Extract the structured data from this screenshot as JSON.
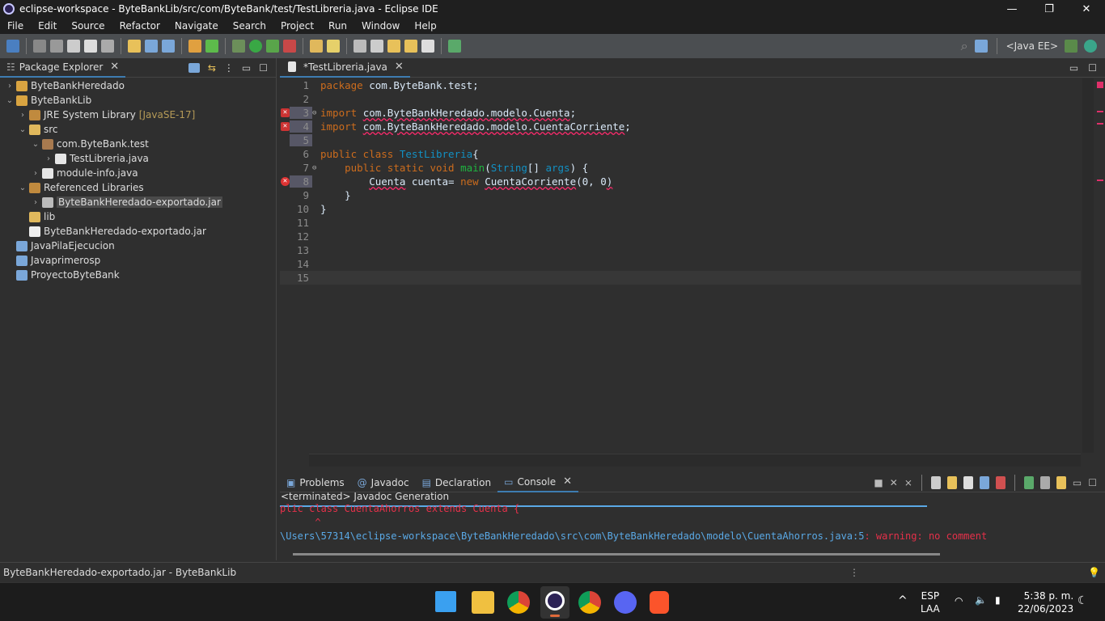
{
  "window": {
    "title": "eclipse-workspace - ByteBankLib/src/com/ByteBank/test/TestLibreria.java - Eclipse IDE",
    "minimize": "—",
    "maximize": "❐",
    "close": "✕"
  },
  "menu": [
    "File",
    "Edit",
    "Source",
    "Refactor",
    "Navigate",
    "Search",
    "Project",
    "Run",
    "Window",
    "Help"
  ],
  "toolbar": {
    "perspective": "<Java EE>"
  },
  "explorer": {
    "tab": "Package Explorer",
    "items": [
      {
        "label": "ByteBankHeredado",
        "depth": 0,
        "chev": "›",
        "icon": "project-warning-icon",
        "color": "#d9a441"
      },
      {
        "label": "ByteBankLib",
        "depth": 0,
        "chev": "⌄",
        "icon": "project-icon",
        "color": "#d9a441"
      },
      {
        "label": "JRE System Library",
        "deco": "[JavaSE-17]",
        "depth": 1,
        "chev": "›",
        "icon": "library-icon",
        "color": "#c08a3e"
      },
      {
        "label": "src",
        "depth": 1,
        "chev": "⌄",
        "icon": "source-folder-icon",
        "color": "#e0b85c"
      },
      {
        "label": "com.ByteBank.test",
        "depth": 2,
        "chev": "⌄",
        "icon": "package-icon",
        "color": "#a87a4f"
      },
      {
        "label": "TestLibreria.java",
        "depth": 3,
        "chev": "›",
        "icon": "java-file-icon",
        "color": "#e6e6e6"
      },
      {
        "label": "module-info.java",
        "depth": 2,
        "chev": "›",
        "icon": "java-file-icon",
        "color": "#e6e6e6"
      },
      {
        "label": "Referenced Libraries",
        "depth": 1,
        "chev": "⌄",
        "icon": "library-icon",
        "color": "#c08a3e"
      },
      {
        "label": "ByteBankHeredado-exportado.jar",
        "depth": 2,
        "chev": "›",
        "icon": "jar-icon",
        "color": "#bbbbbb",
        "selected": true
      },
      {
        "label": "lib",
        "depth": 1,
        "chev": "",
        "icon": "folder-icon",
        "color": "#e0b85c"
      },
      {
        "label": "ByteBankHeredado-exportado.jar",
        "depth": 1,
        "chev": "",
        "icon": "file-icon",
        "color": "#eeeeee"
      },
      {
        "label": "JavaPilaEjecucion",
        "depth": 0,
        "chev": "",
        "icon": "closed-project-icon",
        "color": "#7aa7d9"
      },
      {
        "label": "Javaprimerosp",
        "depth": 0,
        "chev": "",
        "icon": "closed-project-icon",
        "color": "#7aa7d9"
      },
      {
        "label": "ProyectoByteBank",
        "depth": 0,
        "chev": "",
        "icon": "closed-project-icon",
        "color": "#7aa7d9"
      }
    ]
  },
  "editor": {
    "tab": "*TestLibreria.java",
    "lines": [
      {
        "n": "1",
        "t": [
          [
            "kw",
            "package "
          ],
          [
            "",
            "com.ByteBank.test;"
          ]
        ]
      },
      {
        "n": "2",
        "t": []
      },
      {
        "n": "3",
        "mark": true,
        "gutter": "error-bulb",
        "fold": true,
        "t": [
          [
            "kw",
            "import "
          ],
          [
            "err",
            "com.ByteBankHeredado.modelo.Cuenta"
          ],
          [
            "",
            ";"
          ]
        ]
      },
      {
        "n": "4",
        "mark": true,
        "gutter": "error-bulb",
        "t": [
          [
            "kw",
            "import "
          ],
          [
            "err",
            "com.ByteBankHeredado.modelo.CuentaCorriente"
          ],
          [
            "",
            ";"
          ]
        ]
      },
      {
        "n": "5",
        "mark": true,
        "t": []
      },
      {
        "n": "6",
        "t": [
          [
            "kw",
            "public class "
          ],
          [
            "cls",
            "TestLibreria"
          ],
          [
            "",
            "{"
          ]
        ]
      },
      {
        "n": "7",
        "fold": true,
        "t": [
          [
            "",
            "    "
          ],
          [
            "kw",
            "public static void "
          ],
          [
            "mth",
            "main"
          ],
          [
            "",
            "("
          ],
          [
            "cls",
            "String"
          ],
          [
            "",
            "[] "
          ],
          [
            "cls",
            "args"
          ],
          [
            "",
            ") {"
          ]
        ]
      },
      {
        "n": "8",
        "mark": true,
        "gutter": "error",
        "t": [
          [
            "",
            "        "
          ],
          [
            "err",
            "Cuenta"
          ],
          [
            "",
            " cuenta= "
          ],
          [
            "kw",
            "new "
          ],
          [
            "err",
            "CuentaCorriente"
          ],
          [
            "",
            "(0, 0"
          ],
          [
            "err",
            ")"
          ]
        ]
      },
      {
        "n": "9",
        "t": [
          [
            "",
            "    }"
          ]
        ]
      },
      {
        "n": "10",
        "t": [
          [
            "",
            "}"
          ]
        ]
      },
      {
        "n": "11",
        "t": []
      },
      {
        "n": "12",
        "t": []
      },
      {
        "n": "13",
        "t": []
      },
      {
        "n": "14",
        "t": []
      },
      {
        "n": "15",
        "cur": true,
        "t": []
      }
    ]
  },
  "bottom": {
    "tabs": [
      "Problems",
      "Javadoc",
      "Declaration",
      "Console"
    ],
    "active": "Console",
    "console_title": "<terminated> Javadoc Generation",
    "lines": [
      {
        "text": "plic class CuentaAhorros extends Cuenta {",
        "color": "#e6304a"
      },
      {
        "text": "      ^",
        "color": "#e6304a"
      },
      {
        "parts": [
          {
            "text": "\\Users\\57314\\eclipse-workspace\\ByteBankHeredado\\src\\com\\ByteBankHeredado\\modelo\\CuentaAhorros.java:5",
            "color": "#5aa9e6"
          },
          {
            "text": ": warning: no comment",
            "color": "#e6304a"
          }
        ]
      }
    ]
  },
  "status": {
    "text": "ByteBankHeredado-exportado.jar - ByteBankLib"
  },
  "taskbar": {
    "lang1": "ESP",
    "lang2": "LAA",
    "time": "5:38 p. m.",
    "date": "22/06/2023"
  },
  "colors": {
    "keyword": "#cc6c1d",
    "class": "#1290c3",
    "method": "#1eb540",
    "error": "#e6304a",
    "accent": "#3e7cb1"
  }
}
